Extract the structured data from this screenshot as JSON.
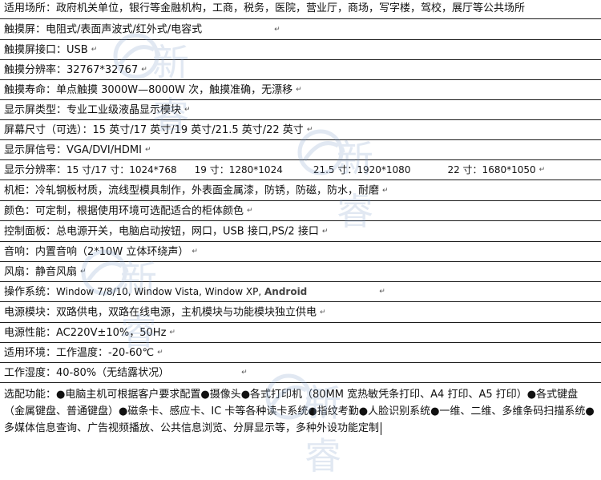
{
  "rows": [
    {
      "label": "适用场所：",
      "value": "政府机关单位，银行等金融机构，工商，税务，医院，营业厅，商场，写字楼，驾校，展厅等公共场所"
    },
    {
      "label": "触摸屏：",
      "value": "电阻式/表面声波式/红外式/电容式"
    },
    {
      "label": "触摸屏接口：",
      "value": "USB"
    },
    {
      "label": "触摸分辨率：",
      "value": "32767*32767"
    },
    {
      "label": "触摸寿命：",
      "value": "单点触摸 3000W—8000W 次，触摸准确，无漂移"
    },
    {
      "label": "显示屏类型：",
      "value": "专业工业级液晶显示模块"
    },
    {
      "label": "屏幕尺寸（可选）：",
      "value": "15 英寸/17 英寸/19 英寸/21.5 英寸/22 英寸"
    },
    {
      "label": "显示屏信号：",
      "value": "VGA/DVI/HDMI"
    },
    {
      "label": "显示分辨率：",
      "parts": [
        "15 寸/17 寸：1024*768",
        "19 寸：1280*1024",
        "21.5 寸：1920*1080",
        "22 寸：1680*1050"
      ]
    },
    {
      "label": "机柜：",
      "value": "冷轧钢板材质，流线型模具制作，外表面金属漆，防锈，防磁，防水，耐磨"
    },
    {
      "label": "颜色：",
      "value": "可定制，根据使用环境可选配适合的柜体颜色"
    },
    {
      "label": "控制面板：",
      "value": "总电源开关，电脑启动按钮，网口，USB 接口,PS/2 接口"
    },
    {
      "label": "音响：",
      "value": "内置音响（2*10W 立体环绕声）"
    },
    {
      "label": "风扇：",
      "value": "静音风扇"
    },
    {
      "label": "操作系统：",
      "value": "Window 7/8/10, Window Vista, Window XP,",
      "extra": "Android"
    },
    {
      "label": "电源模块：",
      "value": "双路供电，双路在线电源，主机模块与功能模块独立供电"
    },
    {
      "label": "电源性能：",
      "value": "AC220V±10%，50Hz"
    },
    {
      "label": "适用环境：",
      "value": "工作温度：-20-60℃"
    },
    {
      "label": "工作湿度：",
      "value": "40-80%（无结露状况）"
    },
    {
      "label": "选配功能：",
      "value": "●电脑主机可根据客户要求配置●摄像头●各式打印机（80MM 宽热敏凭条打印、A4 打印、A5 打印）●各式键盘（金属键盘、普通键盘）●磁条卡、感应卡、IC 卡等各种读卡系统●指纹考勤●人脸识别系统●一维、二维、多维条码扫描系统●多媒体信息查询、广告视频播放、公共信息浏览、分屏显示等，多种外设功能定制"
    }
  ],
  "watermark": {
    "text": "新睿"
  },
  "para_mark": "↵"
}
